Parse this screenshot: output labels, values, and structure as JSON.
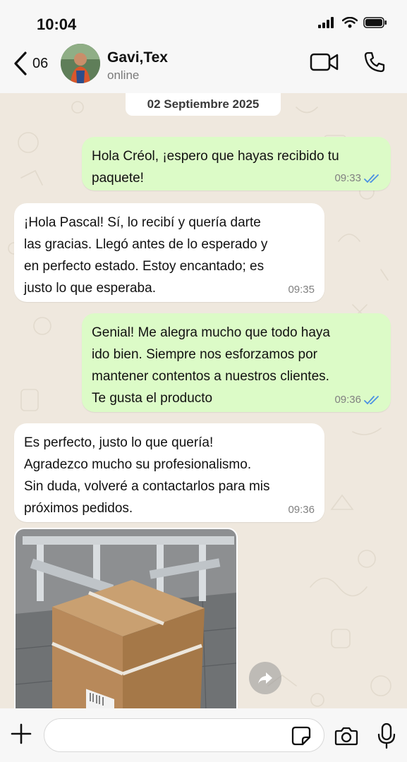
{
  "status_bar": {
    "time": "10:04",
    "icons": [
      "signal-icon",
      "wifi-icon",
      "battery-icon"
    ]
  },
  "header": {
    "back_count": "06",
    "contact_name": "Gavi,Tex",
    "contact_status": "online",
    "actions": [
      "video-call-icon",
      "phone-call-icon"
    ]
  },
  "chat": {
    "background_color": "#efe8de",
    "date_label": "02 Septiembre 2025",
    "messages": [
      {
        "direction": "out",
        "lines": [
          "Hola Créol, ¡espero que hayas recibido tu",
          "paquete!"
        ],
        "time": "09:33",
        "read": true
      },
      {
        "direction": "in",
        "lines": [
          "¡Hola Pascal! Sí, lo recibí y quería darte",
          "las gracias. Llegó antes de lo esperado y",
          "en perfecto estado. Estoy encantado; es",
          "justo lo que esperaba."
        ],
        "time": "09:35"
      },
      {
        "direction": "out",
        "lines": [
          "Genial! Me alegra mucho que todo haya",
          "ido bien. Siempre nos esforzamos por",
          "mantener contentos a nuestros clientes.",
          "Te gusta el producto"
        ],
        "time": "09:36",
        "read": true
      },
      {
        "direction": "in",
        "lines": [
          "Es perfecto, justo lo que quería!",
          "Agradezco mucho su profesionalismo.",
          "Sin duda, volveré a contactarlos para mis",
          "próximos pedidos."
        ],
        "time": "09:36"
      }
    ],
    "photo": {
      "type": "image",
      "subject": "cardboard box on a tiled floor"
    }
  },
  "composer": {
    "placeholder": "",
    "icons": [
      "plus-icon",
      "sticker-icon",
      "camera-icon",
      "microphone-icon"
    ]
  },
  "colors": {
    "outgoing_bubble": "#dcfbc7",
    "incoming_bubble": "#ffffff",
    "read_ticks": "#4a90e2",
    "bar_background": "#f7f7f7"
  }
}
